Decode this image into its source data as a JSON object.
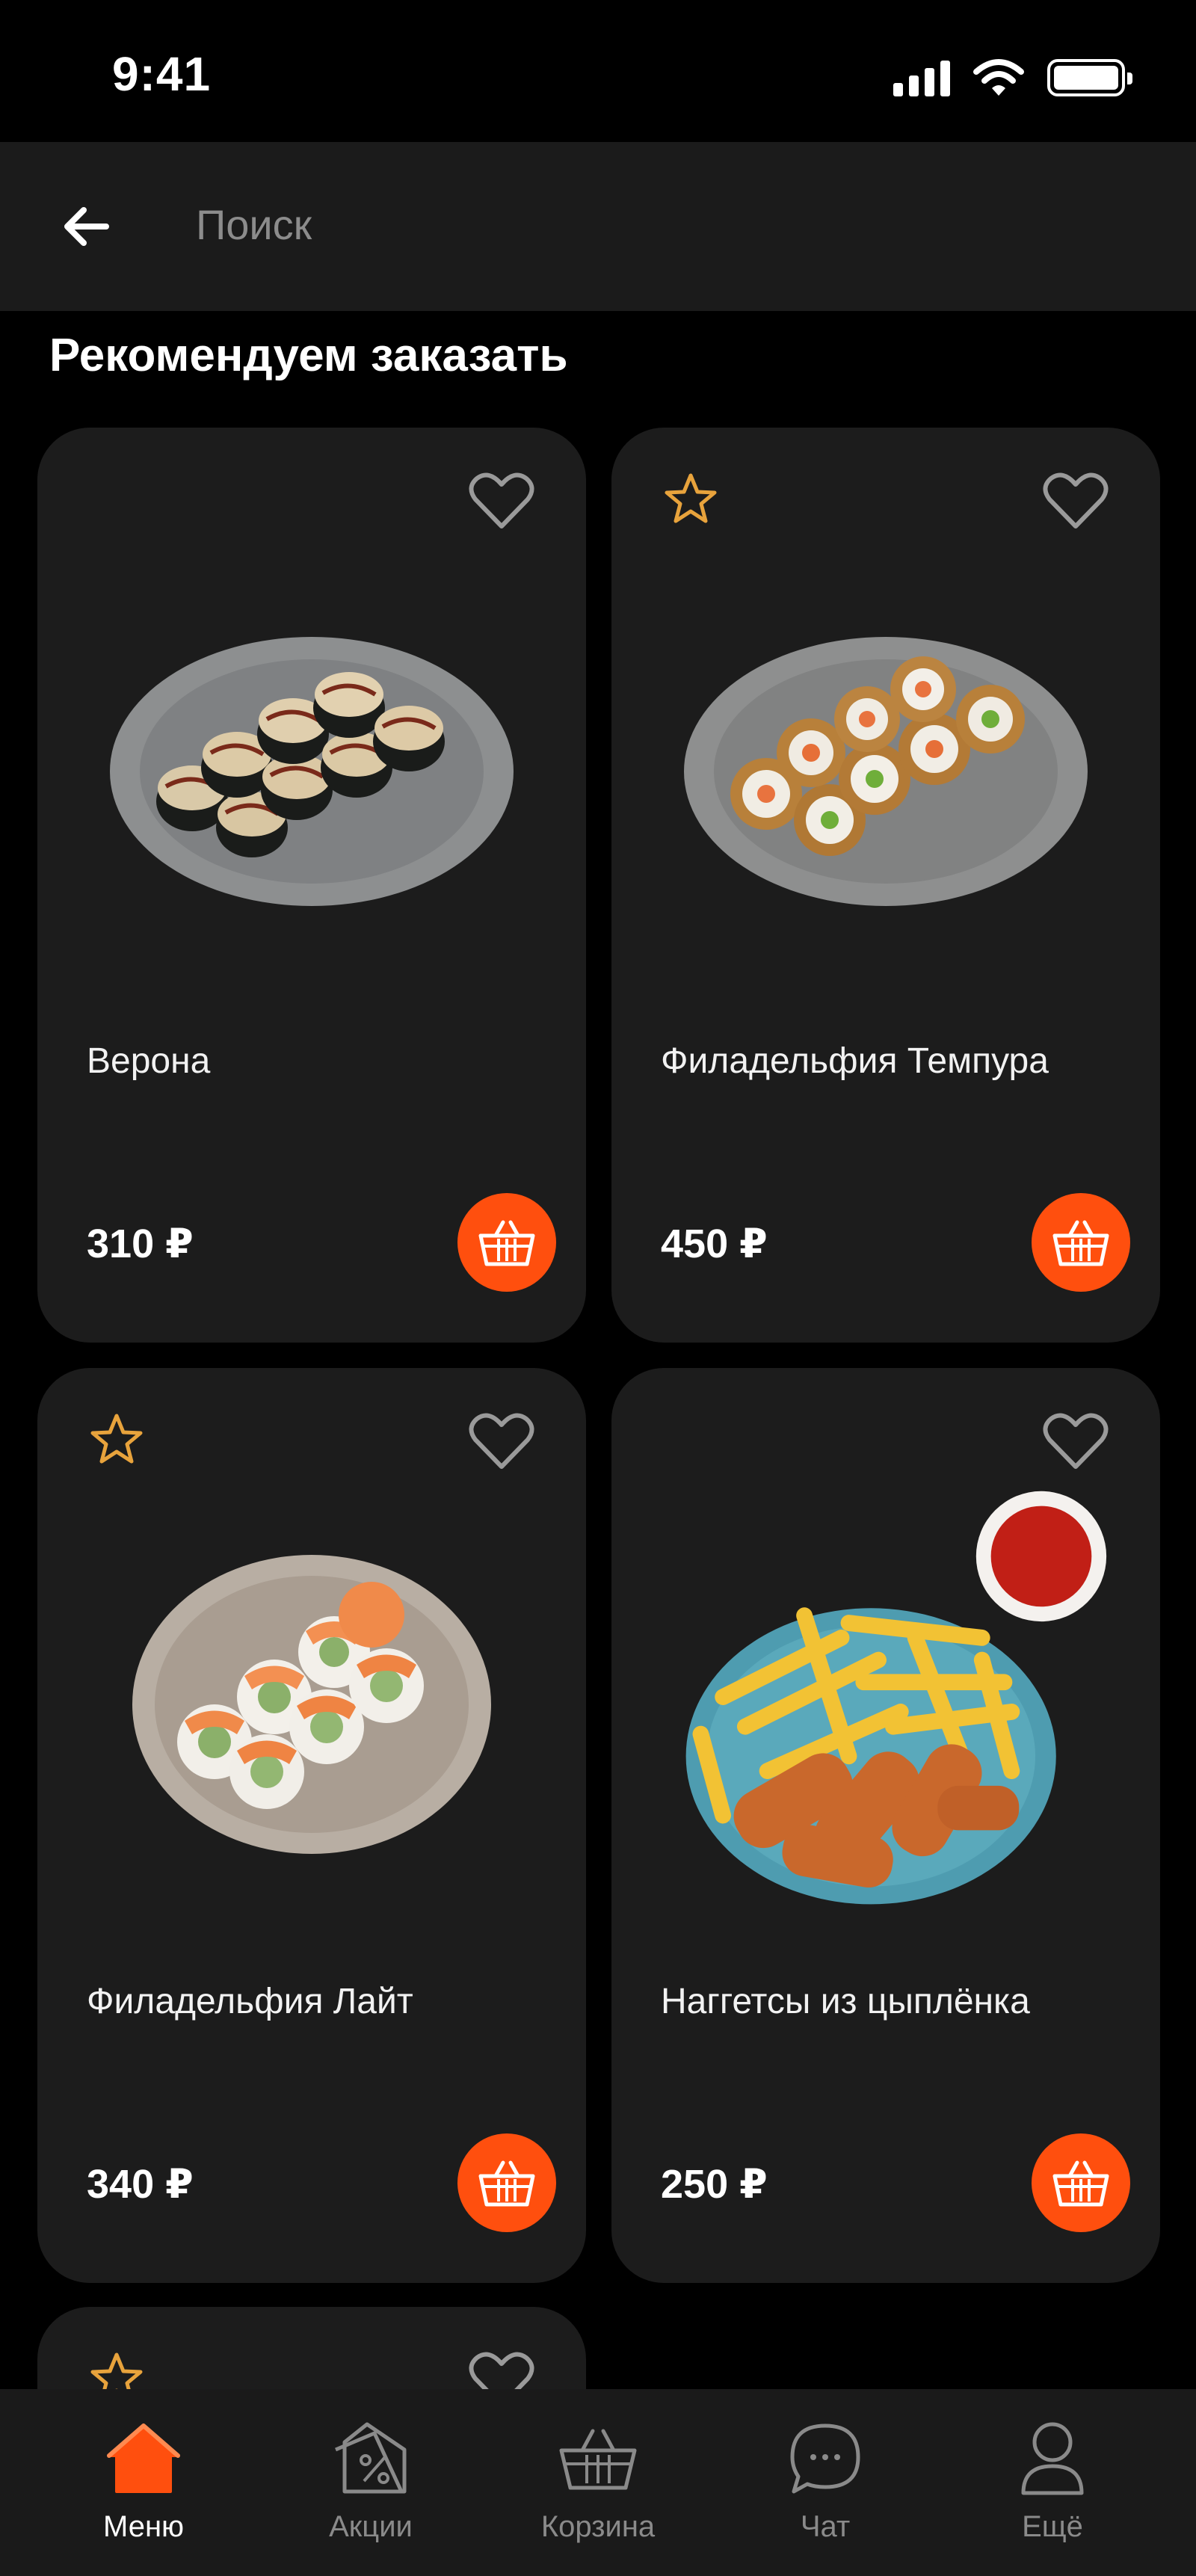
{
  "status_bar": {
    "time": "9:41"
  },
  "search": {
    "placeholder": "Поиск"
  },
  "section": {
    "title": "Рекомендуем заказать"
  },
  "products": [
    {
      "name": "Верона",
      "price": "310 ₽",
      "starred": false
    },
    {
      "name": "Филадельфия Темпура",
      "price": "450 ₽",
      "starred": true
    },
    {
      "name": "Филадельфия Лайт",
      "price": "340 ₽",
      "starred": true
    },
    {
      "name": "Наггетсы из цыплёнка",
      "price": "250 ₽",
      "starred": false
    }
  ],
  "tab_bar": {
    "items": [
      {
        "label": "Меню",
        "icon": "home-icon",
        "active": true
      },
      {
        "label": "Акции",
        "icon": "discount-tag-icon",
        "active": false
      },
      {
        "label": "Корзина",
        "icon": "basket-icon",
        "active": false
      },
      {
        "label": "Чат",
        "icon": "chat-bubble-icon",
        "active": false
      },
      {
        "label": "Ещё",
        "icon": "profile-icon",
        "active": false
      }
    ]
  },
  "colors": {
    "accent": "#ff4f0e",
    "star": "#e8a33c",
    "card_bg": "#1c1c1c",
    "background": "#000000"
  }
}
